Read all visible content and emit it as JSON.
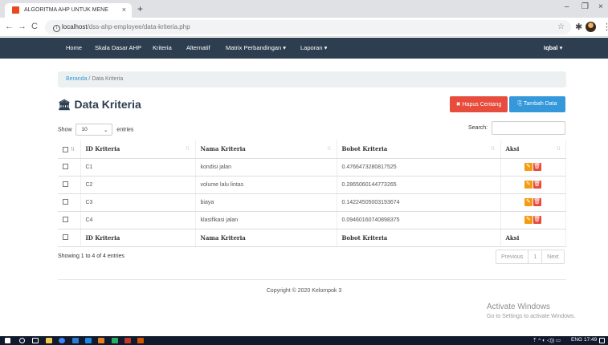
{
  "browser": {
    "tab_title": "ALGORITMA AHP UNTUK MENE",
    "tab_close": "×",
    "new_tab": "+",
    "minimize": "–",
    "maximize": "❐",
    "close": "×",
    "back": "←",
    "forward": "→",
    "reload": "C",
    "info_icon": "i",
    "url_host": "localhost",
    "url_path": "/dss-ahp-employee/data-kriteria.php",
    "star": "☆",
    "puzzle": "✱",
    "menu": "⋮"
  },
  "nav": {
    "home": "Home",
    "skala": "Skala Dasar AHP",
    "kriteria": "Kriteria",
    "alternatif": "Alternatif",
    "matrix": "Matrix Perbandingan ▾",
    "laporan": "Laporan ▾",
    "user": "Iqbal ▾"
  },
  "breadcrumb": {
    "home": "Beranda",
    "sep": "/",
    "current": "Data Kriteria"
  },
  "page": {
    "title": "Data Kriteria",
    "hapus_label": "✖ Hapus Centang",
    "tambah_label": "⎘ Tambah Data"
  },
  "table_controls": {
    "show": "Show",
    "length_value": "10",
    "entries": "entries",
    "search": "Search:"
  },
  "table": {
    "columns": [
      "ID Kriteria",
      "Nama Kriteria",
      "Bobot Kriteria",
      "Aksi"
    ],
    "rows": [
      {
        "id": "C1",
        "nama": "kondisi jalan",
        "bobot": "0.4766473280817525"
      },
      {
        "id": "C2",
        "nama": "volume lalu lintas",
        "bobot": "0.2865060144773265"
      },
      {
        "id": "C3",
        "nama": "biaya",
        "bobot": "0.14224505003193674"
      },
      {
        "id": "C4",
        "nama": "klasifikasi jalan",
        "bobot": "0.09460160740898375"
      }
    ],
    "edit_icon": "✎",
    "delete_icon": "🗑"
  },
  "footer_info": "Showing 1 to 4 of 4 entries",
  "pagination": {
    "previous": "Previous",
    "page": "1",
    "next": "Next"
  },
  "copyright": "Copyright © 2020 Kelompok 3",
  "watermark": {
    "title": "Activate Windows",
    "subtitle": "Go to Settings to activate Windows."
  },
  "taskbar": {
    "lang": "ENG",
    "time": "17:49"
  },
  "colors": {
    "navbar": "#2c3e50",
    "danger": "#e74c3c",
    "info": "#3498db",
    "warning": "#f39c12"
  }
}
